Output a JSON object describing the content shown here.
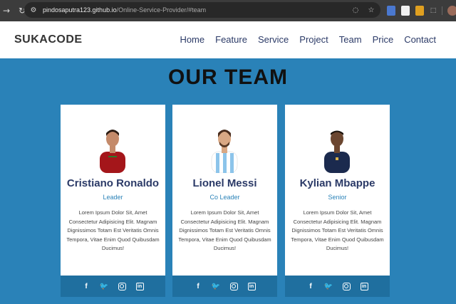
{
  "browser": {
    "url_host": "pindosaputra123.github.io",
    "url_path": "/Online-Service-Provider/#team"
  },
  "navbar": {
    "brand": "SUKACODE",
    "items": [
      "Home",
      "Feature",
      "Service",
      "Project",
      "Team",
      "Price",
      "Contact"
    ]
  },
  "section": {
    "title": "OUR TEAM"
  },
  "team": [
    {
      "name": "Cristiano Ronaldo",
      "role": "Leader",
      "bio": "Lorem Ipsum Dolor Sit, Amet Consectetur Adipisicing Elit. Magnam Dignissimos Totam Est Veritatis Omnis Tempora, Vitae Enim Quod Quibusdam Ducimus!",
      "jersey_color": "#a4161a"
    },
    {
      "name": "Lionel Messi",
      "role": "Co Leader",
      "bio": "Lorem Ipsum Dolor Sit, Amet Consectetur Adipisicing Elit. Magnam Dignissimos Totam Est Veritatis Omnis Tempora, Vitae Enim Quod Quibusdam Ducimus!",
      "jersey_color": "#8cc4ea"
    },
    {
      "name": "Kylian Mbappe",
      "role": "Senior",
      "bio": "Lorem Ipsum Dolor Sit, Amet Consectetur Adipisicing Elit. Magnam Dignissimos Totam Est Veritatis Omnis Tempora, Vitae Enim Quod Quibusdam Ducimus!",
      "jersey_color": "#1b2a4e"
    }
  ],
  "social_icons": [
    "facebook-icon",
    "twitter-icon",
    "instagram-icon",
    "linkedin-icon"
  ],
  "colors": {
    "section_bg": "#2a82b8",
    "card_footer": "#1f6f9f",
    "name_text": "#2b3a67",
    "role_text": "#2a82b8"
  }
}
